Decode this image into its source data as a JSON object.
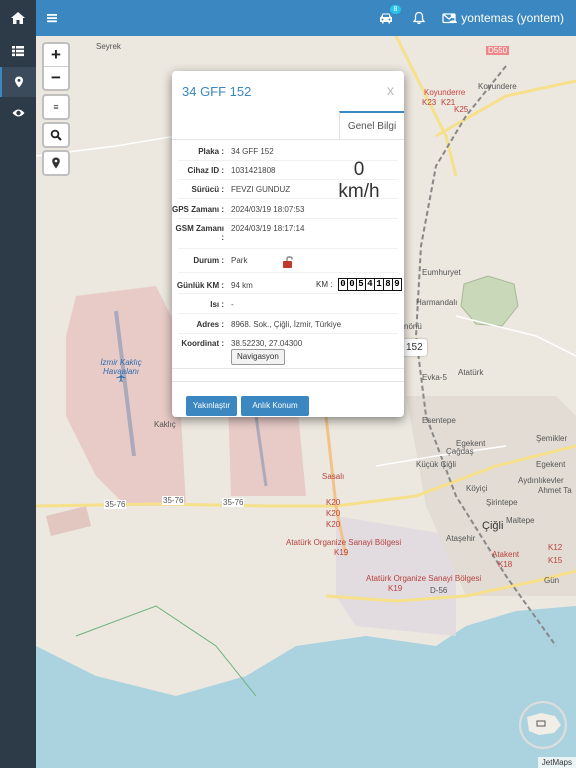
{
  "topbar": {
    "home_icon": "home-icon",
    "menu_icon": "menu-icon",
    "car_icon": "car-icon",
    "car_badge": "8",
    "bell_icon": "bell-icon",
    "mail_icon": "envelope-icon",
    "user_label": "yontemas (yontem)"
  },
  "sidebar": {
    "items": [
      {
        "icon": "list-icon"
      },
      {
        "icon": "map-marker-icon",
        "active": true
      },
      {
        "icon": "eye-icon"
      }
    ]
  },
  "map_controls": {
    "zoom_in": "+",
    "zoom_out": "−",
    "layers_label": "≡",
    "search_icon": "search-icon",
    "marker_icon": "map-marker-icon"
  },
  "map": {
    "labels": [
      "Seyrek",
      "D550",
      "Koyunderre",
      "K23",
      "K21",
      "K25",
      "Koyundere",
      "Eumhuryet",
      "Harmandalı",
      "Evka-5",
      "Atatürk",
      "Esentepe",
      "Egekent",
      "Çağdaş",
      "Küçük Çiğli",
      "Köyiçi",
      "Şirintepe",
      "Ahmet Ta",
      "Egekent",
      "Aydınlıkevler",
      "Çiğli",
      "Maltepe",
      "Ataşehir",
      "İzmir Kaklıç Havaalanı",
      "Kaklıç",
      "35-76",
      "35-76",
      "35-76",
      "Sasalı",
      "K20",
      "K20",
      "K20",
      "Atatürk Organize Sanayi Bölgesi",
      "K19",
      "Atatürk Organize Sanayi Bölgesi",
      "K19",
      "D-56",
      "Atakent",
      "K18",
      "K12",
      "K15",
      "Şemikler",
      "Gün",
      "nönü"
    ],
    "vehicle_marker": "152",
    "attribution": "JetMaps"
  },
  "modal": {
    "title": "34 GFF 152",
    "close": "x",
    "tab": "Genel Bilgi",
    "rows": [
      {
        "label": "Plaka :",
        "value": "34 GFF 152"
      },
      {
        "label": "Cihaz ID :",
        "value": "1031421808"
      },
      {
        "label": "Sürücü :",
        "value": "FEVZI GUNDUZ"
      },
      {
        "label": "GPS Zamanı :",
        "value": "2024/03/19 18:07:53"
      },
      {
        "label": "GSM Zamanı :",
        "value": "2024/03/19 18:17:14"
      },
      {
        "label": "Durum :",
        "value": "Park"
      },
      {
        "label": "Günlük KM :",
        "value": "94 km"
      },
      {
        "label": "Isı :",
        "value": "-"
      },
      {
        "label": "Adres :",
        "value": "8968. Sok., Çiğli, İzmir, Türkiye"
      },
      {
        "label": "Koordinat :",
        "value": "38.52230, 27.04300"
      }
    ],
    "speed_value": "0",
    "speed_unit": "km/h",
    "km_label": "KM :",
    "odometer_digits": [
      "0",
      "0",
      "5",
      "4",
      "1",
      "8",
      "9"
    ],
    "status_icon": "unlock-icon",
    "status_color": "#c0392b",
    "navigate_button": "Navigasyon",
    "zoom_button": "Yakınlaştır",
    "live_location_button": "Anlık Konum"
  },
  "colors": {
    "topbar": "#3a87c1",
    "sidebar": "#2d3a48",
    "accent": "#3a87c1",
    "water": "#aad3df",
    "airport": "#e8c6c3"
  }
}
